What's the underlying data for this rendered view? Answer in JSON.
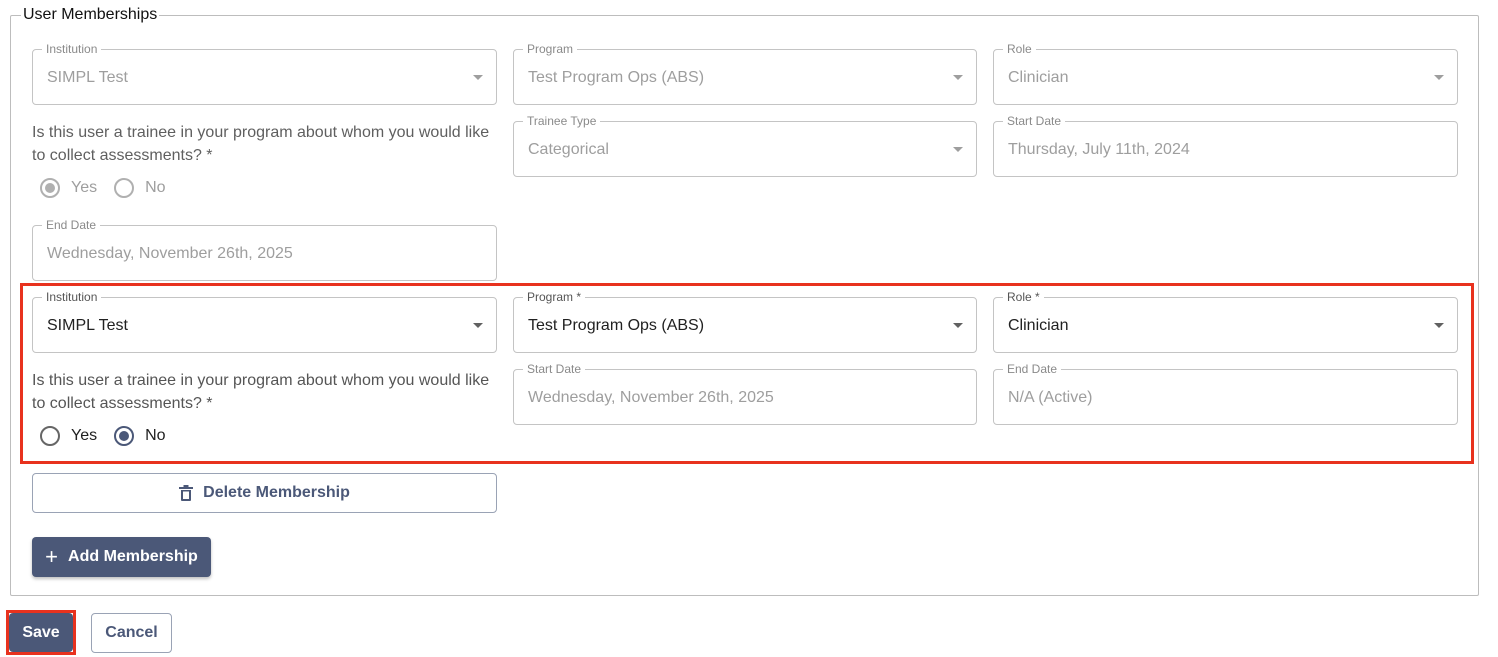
{
  "section": {
    "legend": "User Memberships"
  },
  "membership1": {
    "institution": {
      "label": "Institution",
      "value": "SIMPL Test"
    },
    "program": {
      "label": "Program",
      "value": "Test Program Ops (ABS)"
    },
    "role": {
      "label": "Role",
      "value": "Clinician"
    },
    "question": "Is this user a trainee in your program about whom you would like to collect assessments? *",
    "yes_label": "Yes",
    "no_label": "No",
    "selected": "Yes",
    "trainee_type": {
      "label": "Trainee Type",
      "value": "Categorical"
    },
    "start_date": {
      "label": "Start Date",
      "value": "Thursday, July 11th, 2024"
    },
    "end_date": {
      "label": "End Date",
      "value": "Wednesday, November 26th, 2025"
    }
  },
  "membership2": {
    "institution": {
      "label": "Institution",
      "value": "SIMPL Test"
    },
    "program": {
      "label": "Program *",
      "value": "Test Program Ops (ABS)"
    },
    "role": {
      "label": "Role *",
      "value": "Clinician"
    },
    "question": "Is this user a trainee in your program about whom you would like to collect assessments? *",
    "yes_label": "Yes",
    "no_label": "No",
    "selected": "No",
    "start_date": {
      "label": "Start Date",
      "value": "Wednesday, November 26th, 2025"
    },
    "end_date": {
      "label": "End Date",
      "value": "N/A (Active)"
    }
  },
  "actions": {
    "delete_membership": "Delete Membership",
    "add_membership": "Add Membership",
    "save": "Save",
    "cancel": "Cancel"
  },
  "colors": {
    "primary": "#4b5878",
    "highlight": "#e8321e"
  }
}
